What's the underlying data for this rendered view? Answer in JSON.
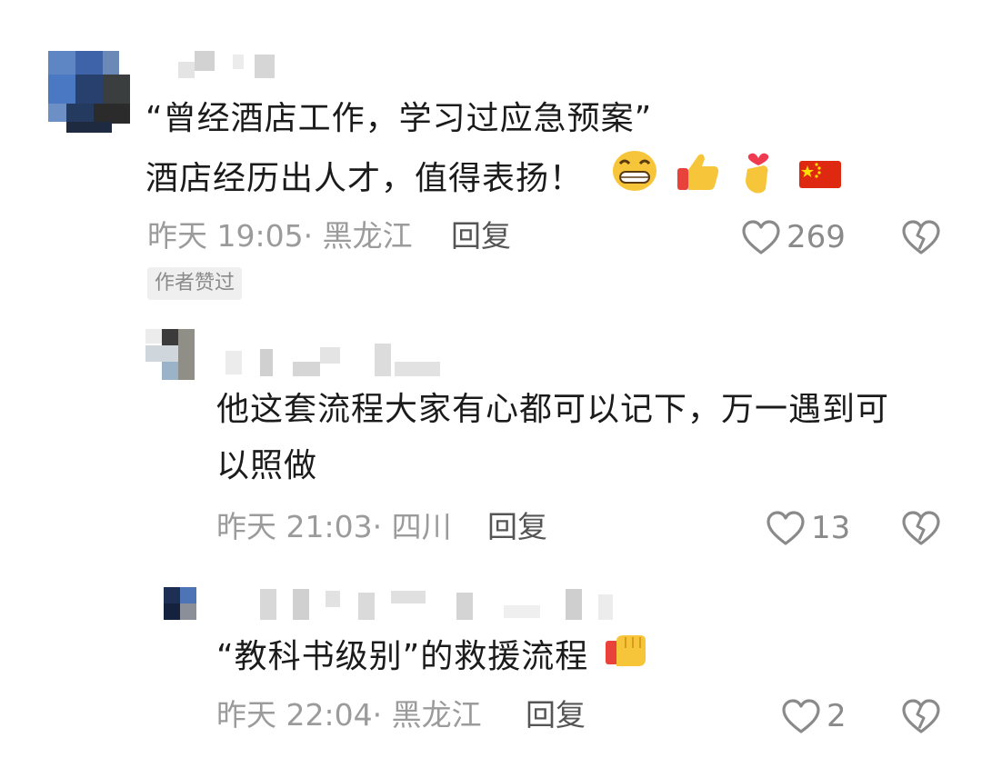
{
  "colors": {
    "meta": "#9b9b9b",
    "text": "#1b1b1b",
    "icon": "#8a8a8a",
    "tag_bg": "#efefef"
  },
  "comments": [
    {
      "text_line1": "“曾经酒店工作，学习过应急预案”",
      "text_line2": "酒店经历出人才，值得表扬！",
      "emojis": [
        "grin-emoji",
        "thumbs-up-emoji",
        "finger-heart-emoji",
        "china-flag-emoji"
      ],
      "time": "昨天 19:05",
      "location": "· 黑龙江",
      "reply": "回复",
      "likes": "269",
      "tag": "作者赞过"
    },
    {
      "text_line1": "他这套流程大家有心都可以记下，万一遇到可",
      "text_line2": "以照做",
      "time": "昨天 21:03",
      "location": "· 四川",
      "reply": "回复",
      "likes": "13"
    },
    {
      "text_line1": "“教科书级别”的救援流程",
      "emojis": [
        "fist-emoji"
      ],
      "time": "昨天 22:04",
      "location": "· 黑龙江",
      "reply": "回复",
      "likes": "2"
    }
  ]
}
